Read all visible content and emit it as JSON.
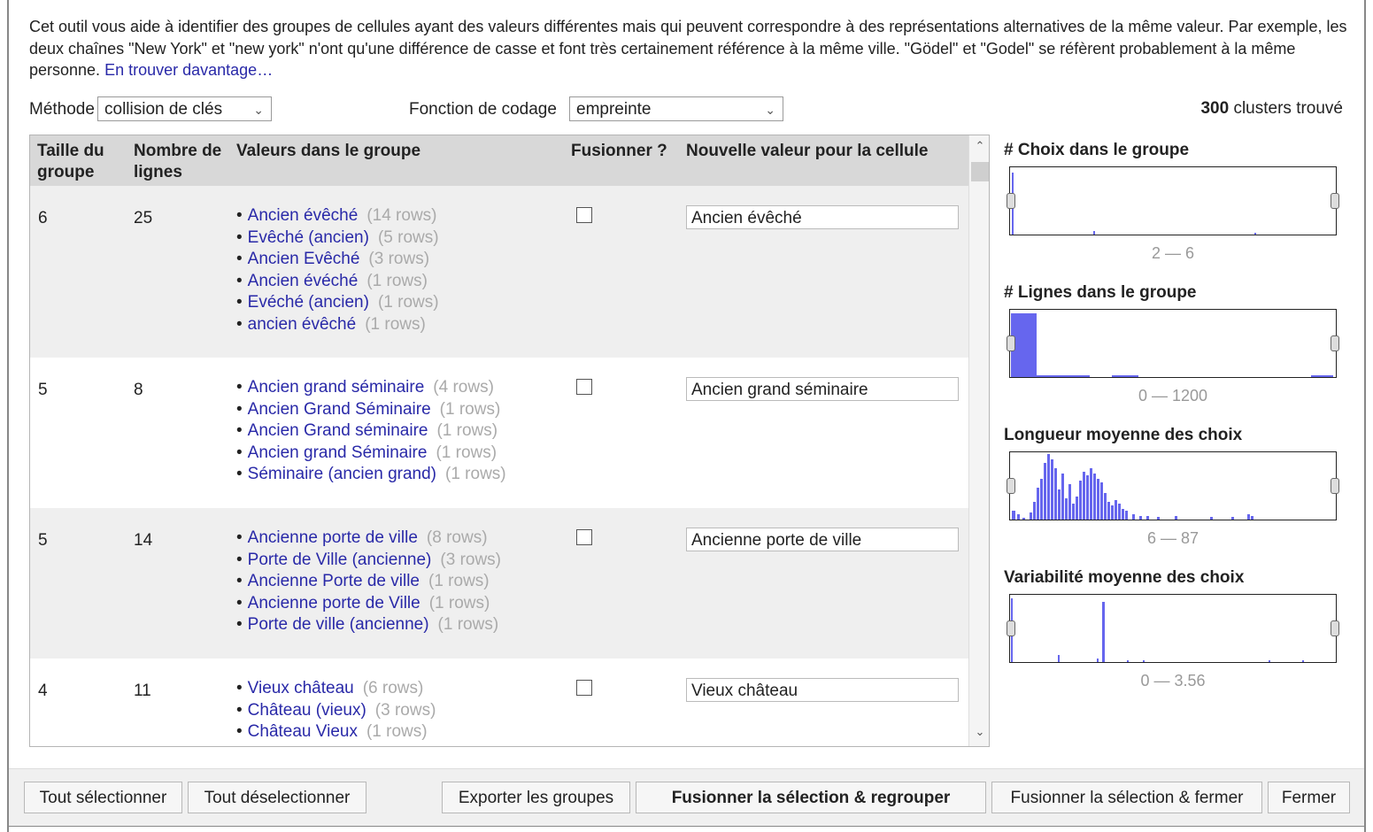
{
  "intro": {
    "text": "Cet outil vous aide à identifier des groupes de cellules ayant des valeurs différentes mais qui peuvent correspondre à des représentations alternatives de la même valeur. Par exemple, les deux chaînes \"New York\" et \"new york\" n'ont qu'une différence de casse et font très certainement référence à la même ville. \"Gödel\" et \"Godel\" se réfèrent probablement à la même personne.",
    "link": "En trouver davantage…"
  },
  "options": {
    "method_label": "Méthode",
    "method_value": "collision de clés",
    "function_label": "Fonction de codage",
    "function_value": "empreinte",
    "clusters_count": "300",
    "clusters_suffix": "clusters trouvé"
  },
  "table": {
    "headers": {
      "size": "Taille du groupe",
      "rows": "Nombre de lignes",
      "values": "Valeurs dans le groupe",
      "merge": "Fusionner ?",
      "new_value": "Nouvelle valeur pour la cellule"
    },
    "rows": [
      {
        "size": "6",
        "count": "25",
        "new_value": "Ancien évêché",
        "values": [
          {
            "v": "Ancien évêché",
            "c": "(14 rows)"
          },
          {
            "v": "Evêché (ancien)",
            "c": "(5 rows)"
          },
          {
            "v": "Ancien Evêché",
            "c": "(3 rows)"
          },
          {
            "v": "Ancien évéché",
            "c": "(1 rows)"
          },
          {
            "v": "Evéché (ancien)",
            "c": "(1 rows)"
          },
          {
            "v": "ancien évêché",
            "c": "(1 rows)"
          }
        ]
      },
      {
        "size": "5",
        "count": "8",
        "new_value": "Ancien grand séminaire",
        "values": [
          {
            "v": "Ancien grand séminaire",
            "c": "(4 rows)"
          },
          {
            "v": "Ancien Grand Séminaire",
            "c": "(1 rows)"
          },
          {
            "v": "Ancien Grand séminaire",
            "c": "(1 rows)"
          },
          {
            "v": "Ancien grand Séminaire",
            "c": "(1 rows)"
          },
          {
            "v": "Séminaire (ancien grand)",
            "c": "(1 rows)"
          }
        ]
      },
      {
        "size": "5",
        "count": "14",
        "new_value": "Ancienne porte de ville",
        "values": [
          {
            "v": "Ancienne porte de ville",
            "c": "(8 rows)"
          },
          {
            "v": "Porte de Ville (ancienne)",
            "c": "(3 rows)"
          },
          {
            "v": "Ancienne Porte de ville",
            "c": "(1 rows)"
          },
          {
            "v": "Ancienne porte de Ville",
            "c": "(1 rows)"
          },
          {
            "v": "Porte de ville (ancienne)",
            "c": "(1 rows)"
          }
        ]
      },
      {
        "size": "4",
        "count": "11",
        "new_value": "Vieux château",
        "values": [
          {
            "v": "Vieux château",
            "c": "(6 rows)"
          },
          {
            "v": "Château (vieux)",
            "c": "(3 rows)"
          },
          {
            "v": "Château Vieux",
            "c": "(1 rows)"
          }
        ]
      }
    ]
  },
  "facets": [
    {
      "title": "# Choix dans le groupe",
      "range": "2 — 6"
    },
    {
      "title": "# Lignes dans le groupe",
      "range": "0 — 1200"
    },
    {
      "title": "Longueur moyenne des choix",
      "range": "6 — 87"
    },
    {
      "title": "Variabilité moyenne des choix",
      "range": "0 — 3.56"
    }
  ],
  "buttons": {
    "select_all": "Tout sélectionner",
    "deselect_all": "Tout déselectionner",
    "export": "Exporter les groupes",
    "merge_recluster": "Fusionner la sélection & regrouper",
    "merge_close": "Fusionner la sélection & fermer",
    "close": "Fermer"
  },
  "colors": {
    "link": "#2929a8",
    "histogram": "#6666ee"
  }
}
